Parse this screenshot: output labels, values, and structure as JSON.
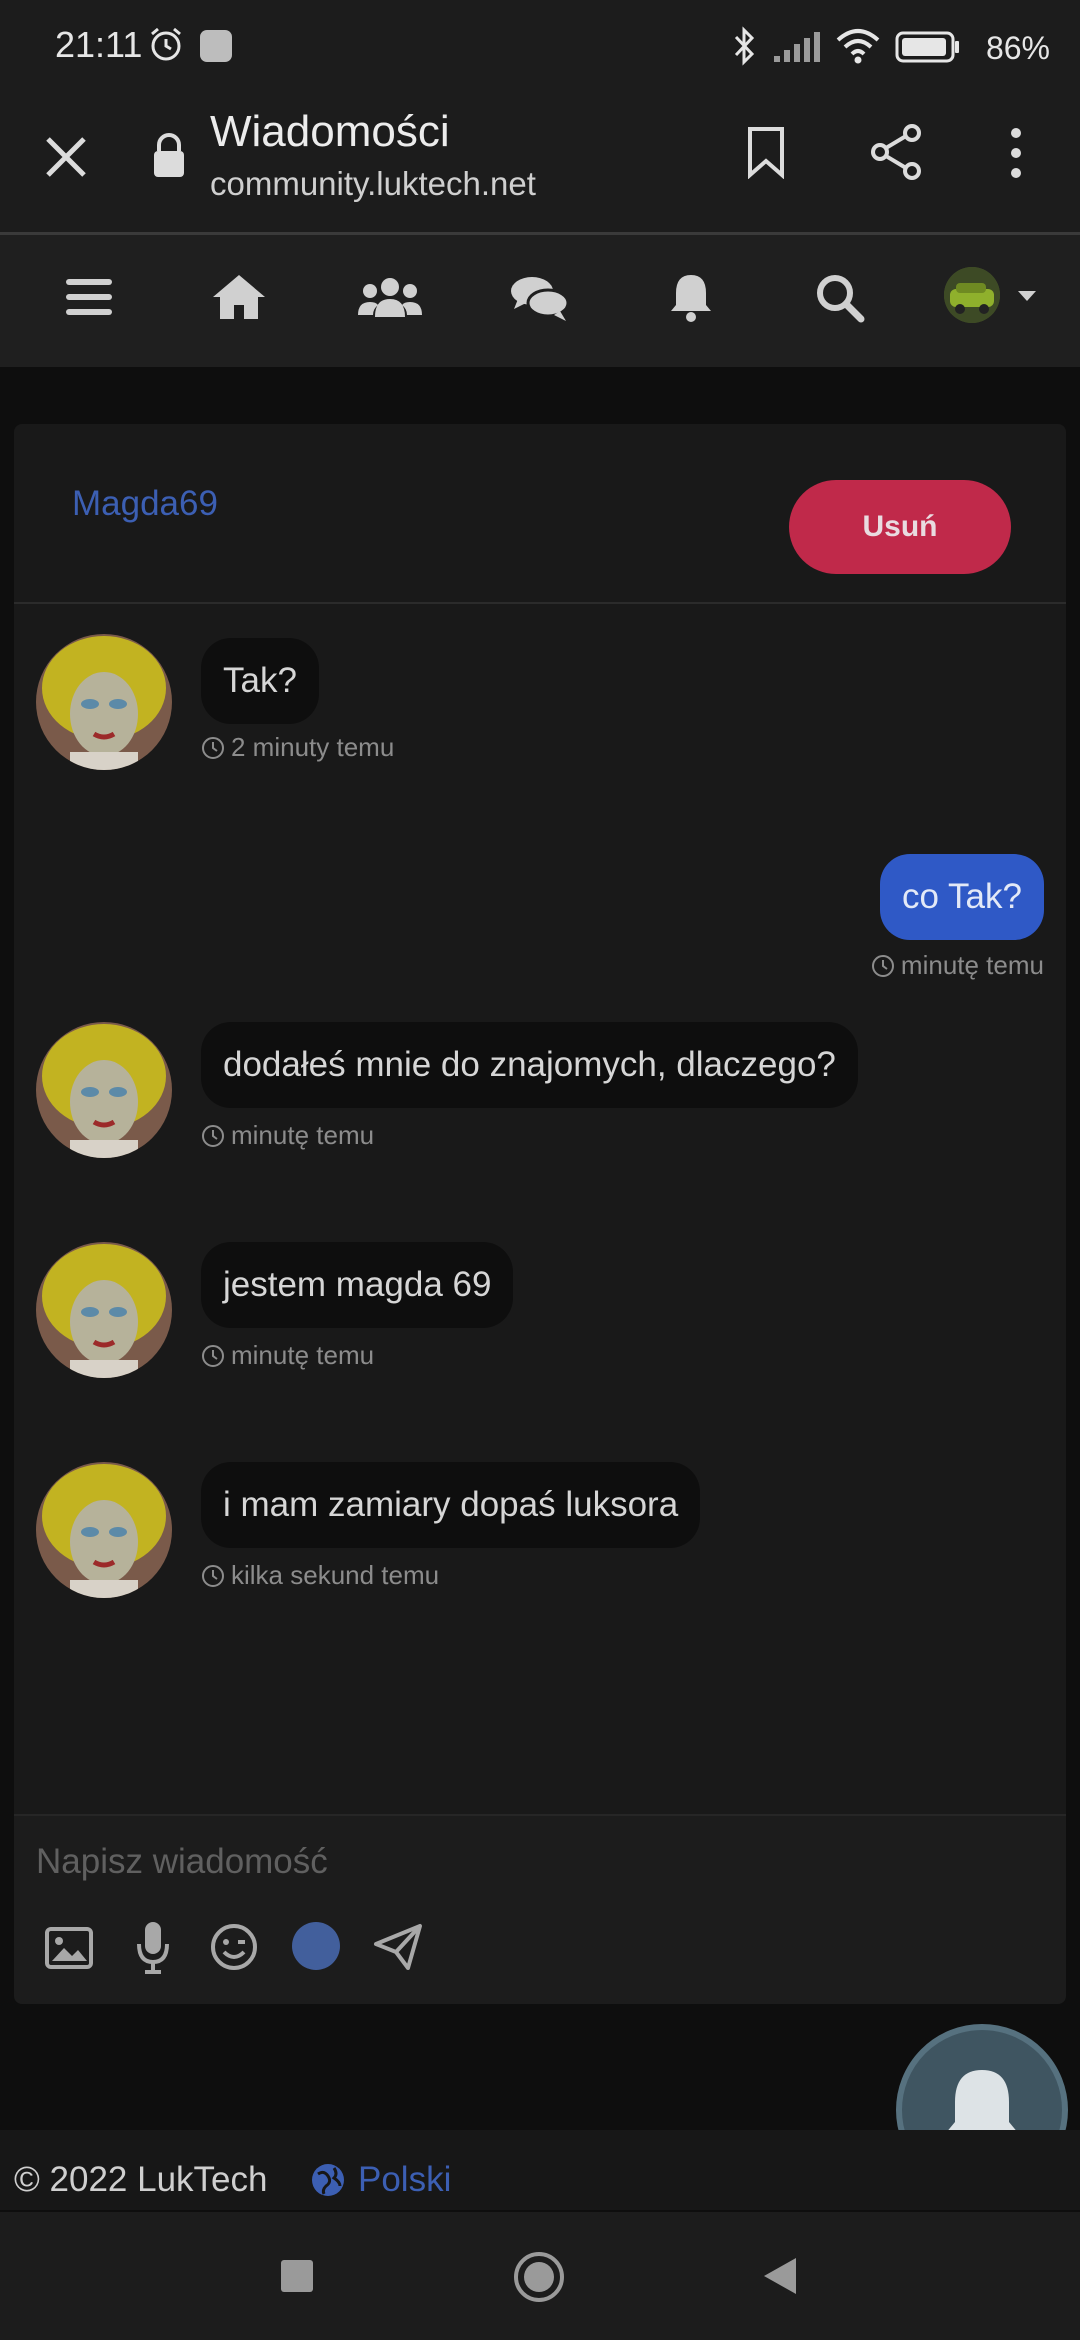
{
  "status_bar": {
    "time": "21:11",
    "battery_pct": "86%"
  },
  "browser": {
    "title": "Wiadomości",
    "url": "community.luktech.net"
  },
  "icons": {
    "close": "close-icon",
    "lock": "lock-icon",
    "bookmark": "bookmark-icon",
    "share": "share-icon",
    "more": "more-vert-icon",
    "menu": "menu-icon",
    "home": "home-icon",
    "users": "users-icon",
    "chat": "chat-icon",
    "bell": "bell-icon",
    "search": "search-icon"
  },
  "chat": {
    "recipient": "Magda69",
    "delete_label": "Usuń",
    "messages": [
      {
        "text": "Tak?",
        "time": "2 minuty temu",
        "mine": false
      },
      {
        "text": "co Tak?",
        "time": "minutę temu",
        "mine": true
      },
      {
        "text": "dodałeś mnie do znajomych, dlaczego?",
        "time": "minutę temu",
        "mine": false
      },
      {
        "text": "jestem magda 69",
        "time": "minutę temu",
        "mine": false
      },
      {
        "text": "i mam zamiary dopaś luksora",
        "time": "kilka sekund temu",
        "mine": false
      }
    ],
    "composer_placeholder": "Napisz wiadomość"
  },
  "footer": {
    "copyright": "© 2022 LukTech",
    "language": "Polski"
  },
  "colors": {
    "accent": "#2f59c6",
    "danger": "#c0294a",
    "link": "#3c5fb3"
  }
}
